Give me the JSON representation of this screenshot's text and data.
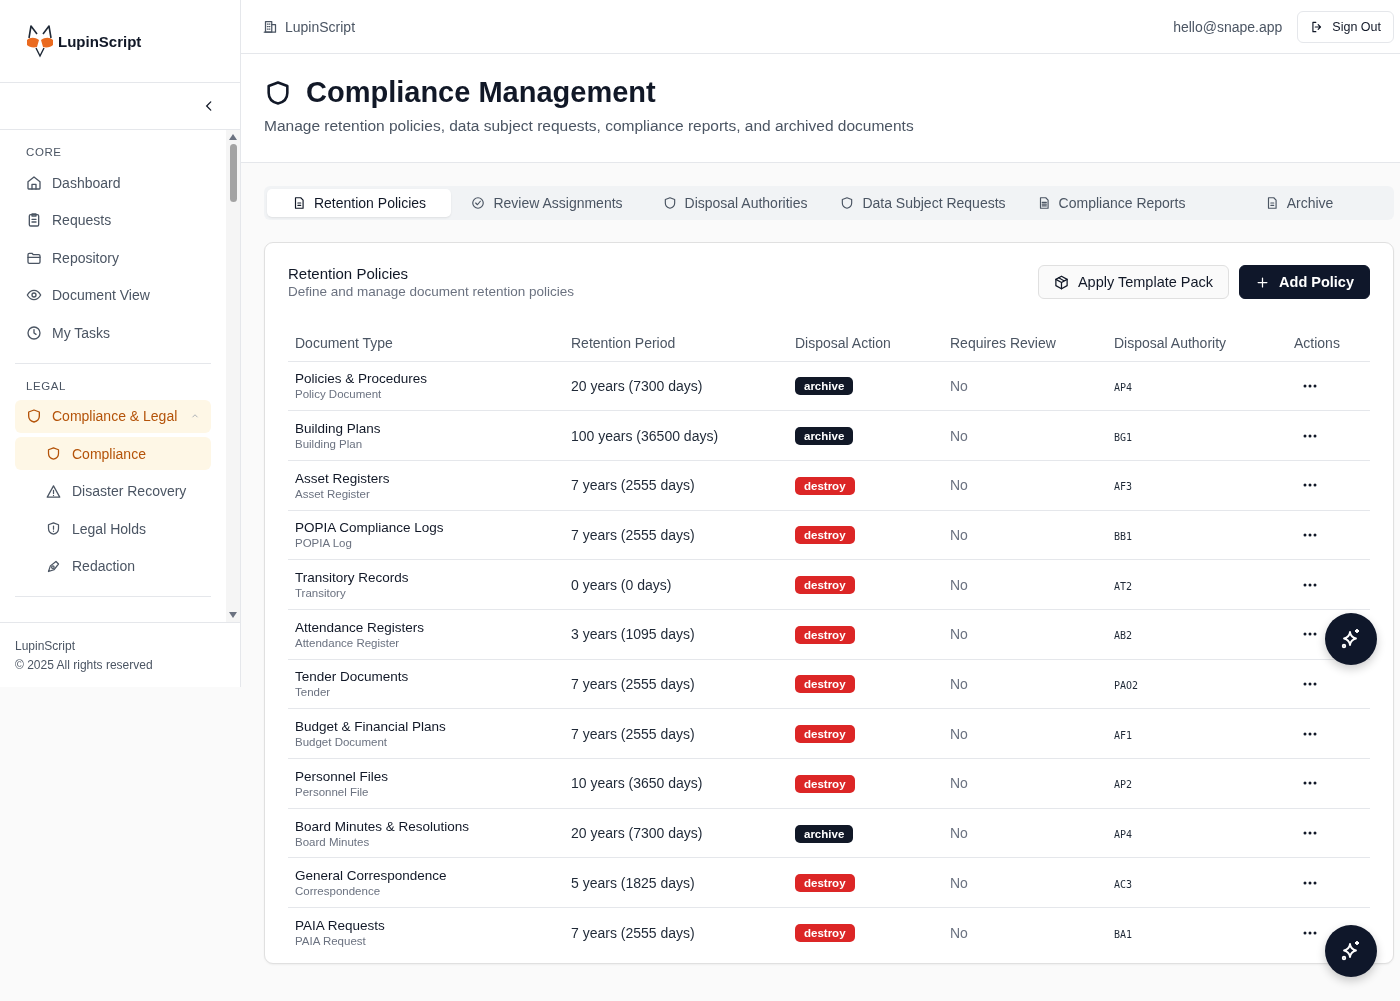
{
  "brand": {
    "name": "LupinScript"
  },
  "sidebar": {
    "sections": [
      {
        "heading": "CORE",
        "items": [
          {
            "label": "Dashboard",
            "selected": false
          },
          {
            "label": "Requests",
            "selected": false
          },
          {
            "label": "Repository",
            "selected": false
          },
          {
            "label": "Document View",
            "selected": false
          },
          {
            "label": "My Tasks",
            "selected": false
          }
        ]
      },
      {
        "heading": "LEGAL",
        "items": [
          {
            "label": "Compliance & Legal",
            "selected": true,
            "expanded": true,
            "children": [
              {
                "label": "Compliance",
                "selected": true
              },
              {
                "label": "Disaster Recovery",
                "selected": false
              },
              {
                "label": "Legal Holds",
                "selected": false
              },
              {
                "label": "Redaction",
                "selected": false
              }
            ]
          }
        ]
      }
    ],
    "footer": {
      "name": "LupinScript",
      "copyright": "© 2025 All rights reserved"
    }
  },
  "topbar": {
    "workspace": "LupinScript",
    "email": "hello@snape.app",
    "sign_out": "Sign Out"
  },
  "page": {
    "title": "Compliance Management",
    "subtitle": "Manage retention policies, data subject requests, compliance reports, and archived documents"
  },
  "tabs": [
    {
      "label": "Retention Policies",
      "selected": true
    },
    {
      "label": "Review Assignments",
      "selected": false
    },
    {
      "label": "Disposal Authorities",
      "selected": false
    },
    {
      "label": "Data Subject Requests",
      "selected": false
    },
    {
      "label": "Compliance Reports",
      "selected": false
    },
    {
      "label": "Archive",
      "selected": false
    }
  ],
  "card": {
    "title": "Retention Policies",
    "subtitle": "Define and manage document retention policies",
    "buttons": [
      {
        "label": "Apply Template Pack",
        "kind": "secondary"
      },
      {
        "label": "Add Policy",
        "kind": "primary"
      }
    ]
  },
  "table": {
    "columns": [
      "Document Type",
      "Retention Period",
      "Disposal Action",
      "Requires Review",
      "Disposal Authority",
      "Actions"
    ],
    "rows": [
      {
        "name": "Policies & Procedures",
        "type": "Policy Document",
        "period": "20 years (7300 days)",
        "action": "archive",
        "color": "#111827",
        "review": "No",
        "authority": "AP4"
      },
      {
        "name": "Building Plans",
        "type": "Building Plan",
        "period": "100 years (36500 days)",
        "action": "archive",
        "color": "#111827",
        "review": "No",
        "authority": "BG1"
      },
      {
        "name": "Asset Registers",
        "type": "Asset Register",
        "period": "7 years (2555 days)",
        "action": "destroy",
        "color": "#dc2626",
        "review": "No",
        "authority": "AF3"
      },
      {
        "name": "POPIA Compliance Logs",
        "type": "POPIA Log",
        "period": "7 years (2555 days)",
        "action": "destroy",
        "color": "#dc2626",
        "review": "No",
        "authority": "BB1"
      },
      {
        "name": "Transitory Records",
        "type": "Transitory",
        "period": "0 years (0 days)",
        "action": "destroy",
        "color": "#dc2626",
        "review": "No",
        "authority": "AT2"
      },
      {
        "name": "Attendance Registers",
        "type": "Attendance Register",
        "period": "3 years (1095 days)",
        "action": "destroy",
        "color": "#dc2626",
        "review": "No",
        "authority": "AB2"
      },
      {
        "name": "Tender Documents",
        "type": "Tender",
        "period": "7 years (2555 days)",
        "action": "destroy",
        "color": "#dc2626",
        "review": "No",
        "authority": "PAO2"
      },
      {
        "name": "Budget & Financial Plans",
        "type": "Budget Document",
        "period": "7 years (2555 days)",
        "action": "destroy",
        "color": "#dc2626",
        "review": "No",
        "authority": "AF1"
      },
      {
        "name": "Personnel Files",
        "type": "Personnel File",
        "period": "10 years (3650 days)",
        "action": "destroy",
        "color": "#dc2626",
        "review": "No",
        "authority": "AP2"
      },
      {
        "name": "Board Minutes & Resolutions",
        "type": "Board Minutes",
        "period": "20 years (7300 days)",
        "action": "archive",
        "color": "#111827",
        "review": "No",
        "authority": "AP4"
      },
      {
        "name": "General Correspondence",
        "type": "Correspondence",
        "period": "5 years (1825 days)",
        "action": "destroy",
        "color": "#dc2626",
        "review": "No",
        "authority": "AC3"
      },
      {
        "name": "PAIA Requests",
        "type": "PAIA Request",
        "period": "7 years (2555 days)",
        "action": "destroy",
        "color": "#dc2626",
        "review": "No",
        "authority": "BA1"
      }
    ]
  }
}
